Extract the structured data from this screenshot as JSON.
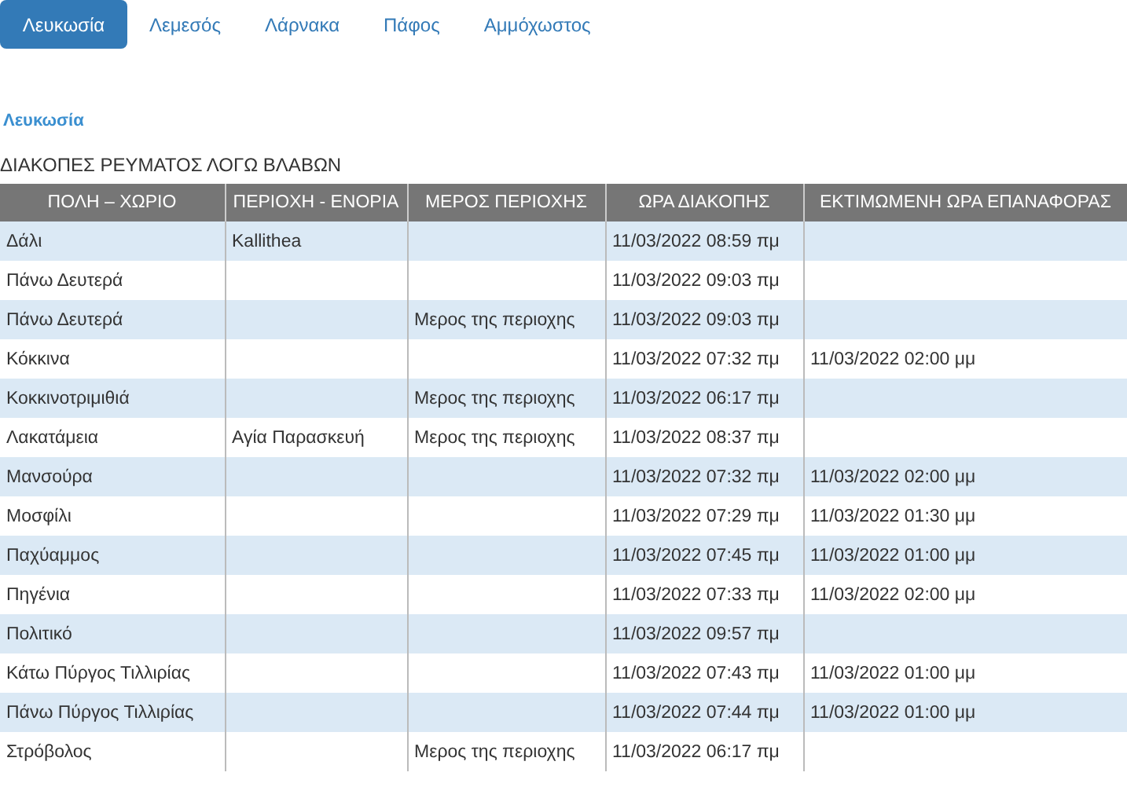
{
  "tabs": [
    {
      "label": "Λευκωσία",
      "selected": true
    },
    {
      "label": "Λεμεσός",
      "selected": false
    },
    {
      "label": "Λάρνακα",
      "selected": false
    },
    {
      "label": "Πάφος",
      "selected": false
    },
    {
      "label": "Αμμόχωστος",
      "selected": false
    }
  ],
  "section_title": "Λευκωσία",
  "heading": "ΔΙΑΚΟΠΕΣ ΡΕΥΜΑΤΟΣ ΛΟΓΩ ΒΛΑΒΩΝ",
  "table": {
    "columns": [
      "ΠΟΛΗ – ΧΩΡΙΟ",
      "ΠΕΡΙΟΧΗ - ΕΝΟΡΙΑ",
      "ΜΕΡΟΣ ΠΕΡΙΟΧΗΣ",
      "ΩΡΑ ΔΙΑΚΟΠΗΣ",
      "ΕΚΤΙΜΩΜΕΝΗ ΩΡΑ ΕΠΑΝΑΦΟΡΑΣ"
    ],
    "rows": [
      [
        "Δάλι",
        "Kallithea",
        "",
        "11/03/2022 08:59 πμ",
        ""
      ],
      [
        "Πάνω Δευτερά",
        "",
        "",
        "11/03/2022 09:03 πμ",
        ""
      ],
      [
        "Πάνω Δευτερά",
        "",
        "Μερος της περιοχης",
        "11/03/2022 09:03 πμ",
        ""
      ],
      [
        "Κόκκινα",
        "",
        "",
        "11/03/2022 07:32 πμ",
        "11/03/2022 02:00 μμ"
      ],
      [
        "Κοκκινοτριμιθιά",
        "",
        "Μερος της περιοχης",
        "11/03/2022 06:17 πμ",
        ""
      ],
      [
        "Λακατάμεια",
        "Αγία Παρασκευή",
        "Μερος της περιοχης",
        "11/03/2022 08:37 πμ",
        ""
      ],
      [
        "Μανσούρα",
        "",
        "",
        "11/03/2022 07:32 πμ",
        "11/03/2022 02:00 μμ"
      ],
      [
        "Μοσφίλι",
        "",
        "",
        "11/03/2022 07:29 πμ",
        "11/03/2022 01:30 μμ"
      ],
      [
        "Παχύαμμος",
        "",
        "",
        "11/03/2022 07:45 πμ",
        "11/03/2022 01:00 μμ"
      ],
      [
        "Πηγένια",
        "",
        "",
        "11/03/2022 07:33 πμ",
        "11/03/2022 02:00 μμ"
      ],
      [
        "Πολιτικό",
        "",
        "",
        "11/03/2022 09:57 πμ",
        ""
      ],
      [
        "Κάτω Πύργος Τιλλιρίας",
        "",
        "",
        "11/03/2022 07:43 πμ",
        "11/03/2022 01:00 μμ"
      ],
      [
        "Πάνω Πύργος Τιλλιρίας",
        "",
        "",
        "11/03/2022 07:44 πμ",
        "11/03/2022 01:00 μμ"
      ],
      [
        "Στρόβολος",
        "",
        "Μερος της περιοχης",
        "11/03/2022 06:17 πμ",
        ""
      ]
    ]
  }
}
